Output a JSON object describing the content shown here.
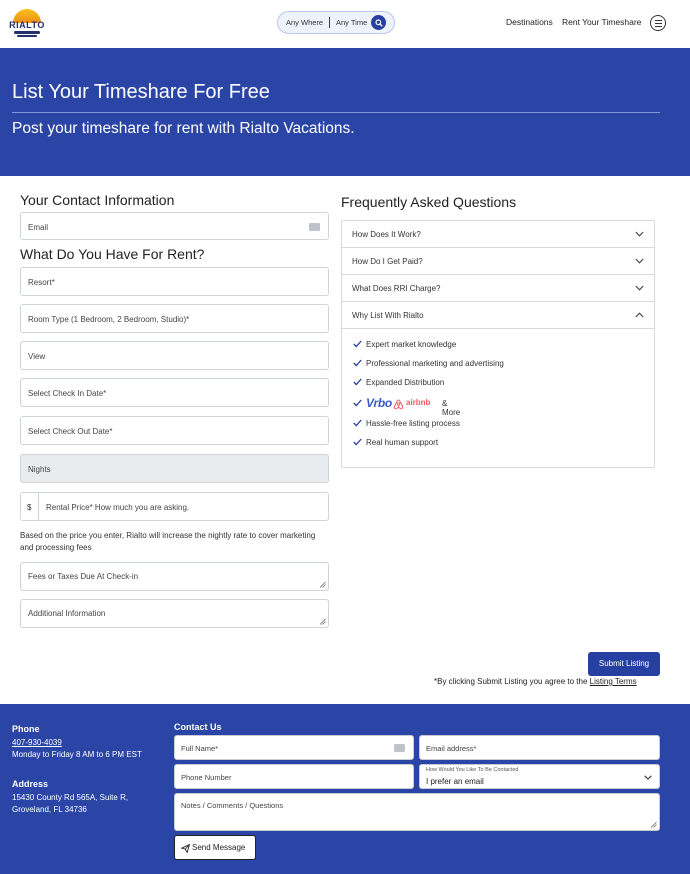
{
  "header": {
    "logo_text": "RIALTO",
    "search": {
      "where": "Any Where",
      "time": "Any Time"
    },
    "nav": {
      "destinations": "Destinations",
      "rent": "Rent Your Timeshare"
    }
  },
  "hero": {
    "title": "List Your Timeshare For Free",
    "subtitle": "Post your timeshare for rent with Rialto Vacations."
  },
  "form": {
    "contact_title": "Your Contact Information",
    "email_placeholder": "Email",
    "rent_title": "What Do You Have For Rent?",
    "resort_placeholder": "Resort*",
    "room_type_placeholder": "Room Type (1 Bedroom, 2 Bedroom, Studio)*",
    "view_placeholder": "View",
    "check_in_placeholder": "Select Check In Date*",
    "check_out_placeholder": "Select Check Out Date*",
    "nights_placeholder": "Nights",
    "currency_symbol": "$",
    "price_placeholder": "Rental Price* How much you are asking.",
    "price_note": "Based on the price you enter, Rialto will increase the nightly rate to cover marketing and processing fees",
    "fees_placeholder": "Fees or Taxes Due At Check-in",
    "additional_placeholder": "Additional Information"
  },
  "faq": {
    "title": "Frequently Asked Questions",
    "questions": [
      "How Does It Work?",
      "How Do I Get Paid?",
      "What Does RRI Charge?",
      "Why List With Rialto"
    ],
    "reasons": [
      "Expert market knowledge",
      "Professional marketing and advertising",
      "Expanded Distribution",
      "Hassle-free listing process",
      "Real human support"
    ],
    "partners": {
      "vrbo": "Vrbo",
      "airbnb": "airbnb",
      "more": "& More"
    }
  },
  "submit": {
    "label": "Submit Listing",
    "agree_text": "*By clicking Submit Listing you agree to the ",
    "terms_link": "Listing Terms"
  },
  "footer": {
    "phone_heading": "Phone",
    "phone_number": "407-930-4039",
    "hours": "Monday to Friday 8 AM to 6 PM EST",
    "address_heading": "Address",
    "address_line1": "15430 County Rd 565A, Suite R,",
    "address_line2": "Groveland, FL 34736",
    "contact_heading": "Contact Us",
    "full_name_placeholder": "Full Name*",
    "email_placeholder": "Email address*",
    "phone_placeholder": "Phone Number",
    "contact_pref_label": "How Would You Like To Be Contacted",
    "contact_pref_value": "I prefer an email",
    "comments_placeholder": "Notes / Comments / Questions",
    "send_label": "Send Message"
  },
  "colors": {
    "brand_blue": "#2a45a6",
    "button_blue": "#2540a0",
    "check_blue": "#2540a0",
    "airbnb_red": "#ff5a5f"
  }
}
